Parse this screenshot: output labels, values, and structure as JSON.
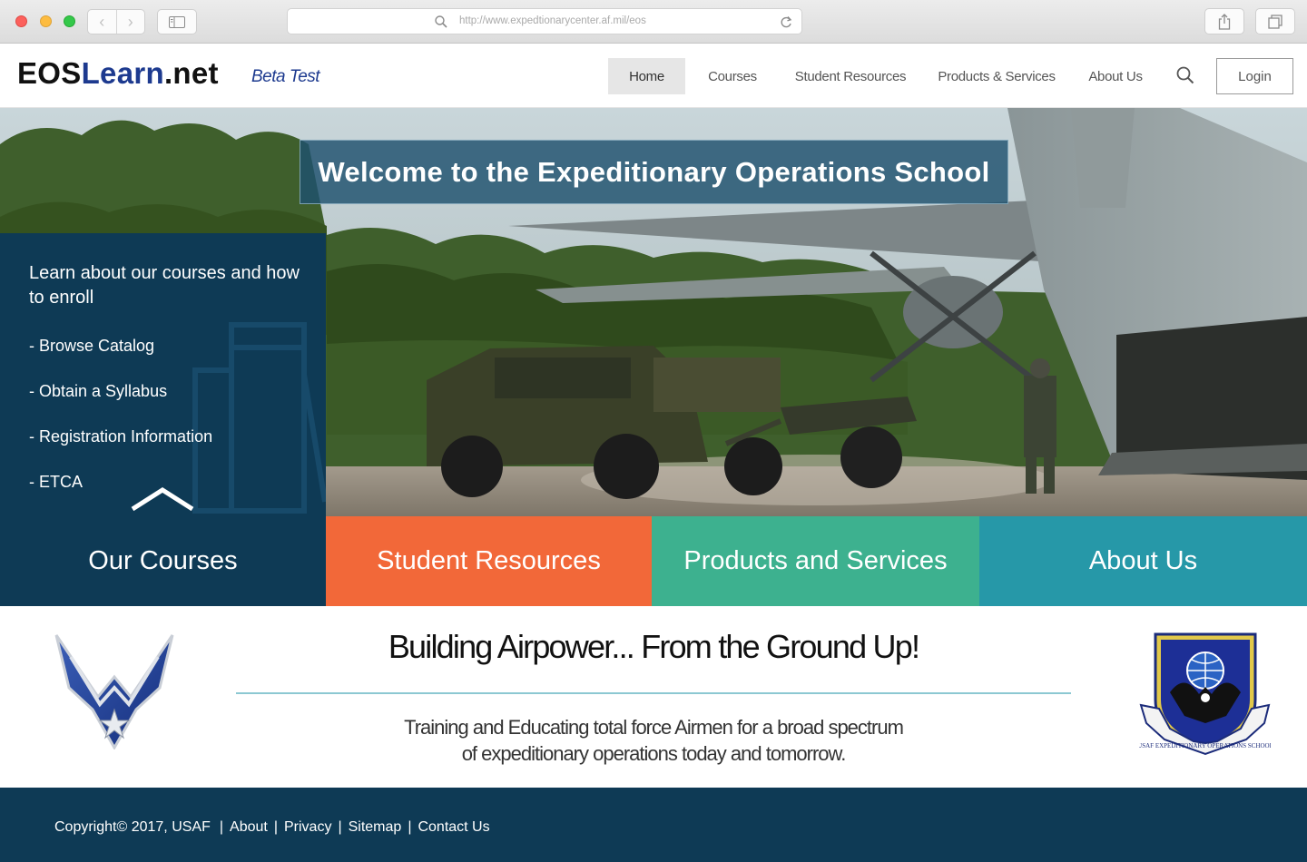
{
  "browser": {
    "url": "http://www.expedtionarycenter.af.mil/eos"
  },
  "header": {
    "logo_prefix": "EOS",
    "logo_mid": "Learn",
    "logo_suffix": ".net",
    "beta_label": "Beta Test",
    "nav": {
      "home": "Home",
      "courses": "Courses",
      "student_resources": "Student Resources",
      "products_services": "Products & Services",
      "about": "About Us"
    },
    "login_label": "Login"
  },
  "hero": {
    "welcome": "Welcome to the Expeditionary Operations School"
  },
  "courses_panel": {
    "intro": "Learn about our courses and how to enroll",
    "links": [
      "- Browse Catalog",
      "- Obtain a Syllabus",
      "- Registration Information",
      "- ETCA"
    ]
  },
  "tiles": {
    "courses": "Our Courses",
    "students": "Student Resources",
    "products": "Products and Services",
    "about": "About Us"
  },
  "tagline": {
    "headline": "Building Airpower...  From the Ground Up!",
    "mission_line1": "Training and Educating total force Airmen for a broad spectrum",
    "mission_line2": "of expeditionary operations today and tomorrow."
  },
  "seal_text": "USAF EXPEDITIONARY OPERATIONS SCHOOL",
  "footer": {
    "copyright": "Copyright© 2017, USAF",
    "links": [
      "About",
      "Privacy",
      "Sitemap",
      "Contact Us"
    ]
  },
  "colors": {
    "navy": "#0e3a55",
    "orange": "#f26839",
    "green": "#3db18f",
    "teal": "#2698a8",
    "brand_blue": "#1d3a8f"
  }
}
